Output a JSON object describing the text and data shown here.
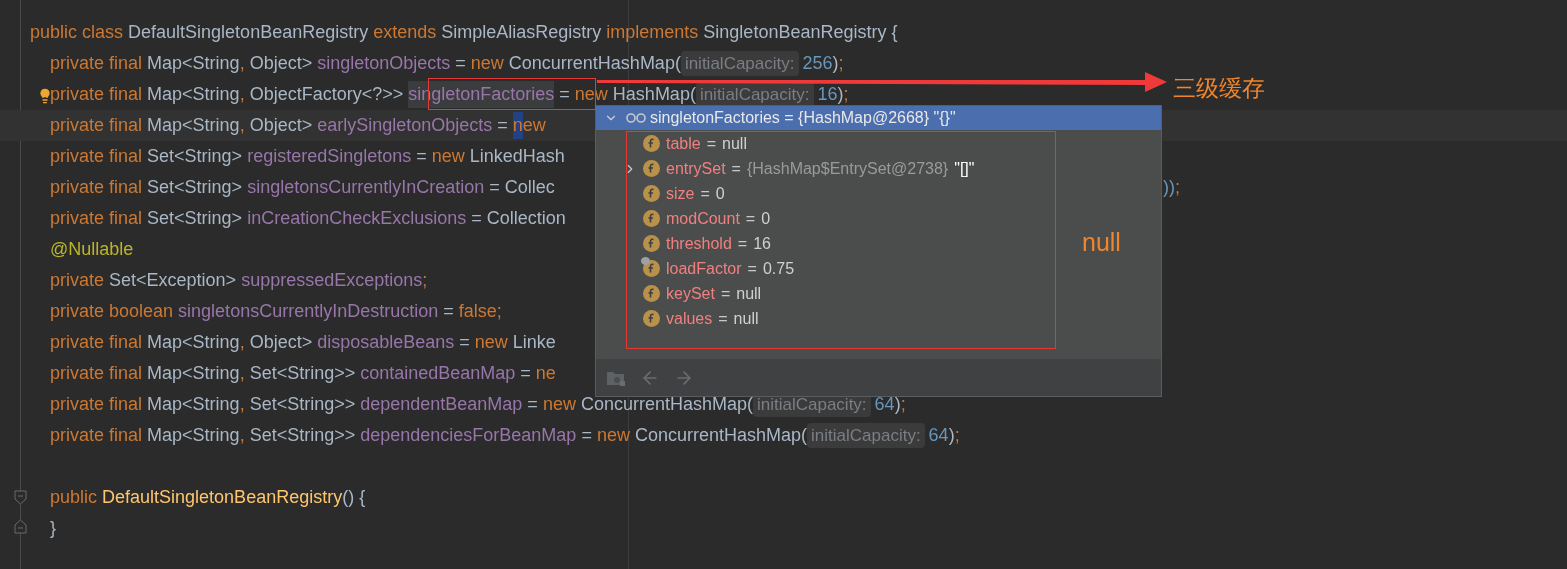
{
  "editor": {
    "lines": [
      {
        "current": false,
        "indented": false,
        "tokens": [
          {
            "kind": "kw",
            "text": "public class "
          },
          {
            "kind": "plain",
            "text": "DefaultSingletonBeanRegistry "
          },
          {
            "kind": "kw",
            "text": "extends "
          },
          {
            "kind": "plain",
            "text": "SimpleAliasRegistry "
          },
          {
            "kind": "kw",
            "text": "implements "
          },
          {
            "kind": "plain",
            "text": "SingletonBeanRegistry {"
          }
        ]
      },
      {
        "current": false,
        "indented": true,
        "tokens": [
          {
            "kind": "kw",
            "text": "private final "
          },
          {
            "kind": "plain",
            "text": "Map<String"
          },
          {
            "kind": "kw",
            "text": ", "
          },
          {
            "kind": "plain",
            "text": "Object> "
          },
          {
            "kind": "field",
            "text": "singletonObjects"
          },
          {
            "kind": "plain",
            "text": " = "
          },
          {
            "kind": "kw",
            "text": "new "
          },
          {
            "kind": "plain",
            "text": "ConcurrentHashMap("
          },
          {
            "kind": "hint",
            "text": "initialCapacity:"
          },
          {
            "kind": "num",
            "text": "256"
          },
          {
            "kind": "plain",
            "text": ")"
          },
          {
            "kind": "kw",
            "text": ";"
          }
        ]
      },
      {
        "current": false,
        "indented": true,
        "gutter": {
          "kind": "bulb"
        },
        "tokens": [
          {
            "kind": "kw",
            "text": "private final "
          },
          {
            "kind": "plain",
            "text": "Map<String"
          },
          {
            "kind": "kw",
            "text": ", "
          },
          {
            "kind": "plain",
            "text": "ObjectFactory<?>> "
          },
          {
            "kind": "usage",
            "text": "singletonFactories"
          },
          {
            "kind": "plain",
            "text": " = "
          },
          {
            "kind": "kw",
            "text": "new "
          },
          {
            "kind": "plain",
            "text": "HashMap("
          },
          {
            "kind": "hint",
            "text": "initialCapacity:"
          },
          {
            "kind": "num",
            "text": "16"
          },
          {
            "kind": "plain",
            "text": ")"
          },
          {
            "kind": "kw",
            "text": ";"
          }
        ]
      },
      {
        "current": true,
        "indented": true,
        "tokens": [
          {
            "kind": "kw",
            "text": "private final "
          },
          {
            "kind": "plain",
            "text": "Map<String"
          },
          {
            "kind": "kw",
            "text": ", "
          },
          {
            "kind": "plain",
            "text": "Object> "
          },
          {
            "kind": "field",
            "text": "earlySingletonObjects"
          },
          {
            "kind": "plain",
            "text": " = "
          },
          {
            "kind": "match",
            "text": "n"
          },
          {
            "kind": "kw",
            "text": "ew"
          }
        ]
      },
      {
        "current": false,
        "indented": true,
        "tokens": [
          {
            "kind": "kw",
            "text": "private final "
          },
          {
            "kind": "plain",
            "text": "Set<String> "
          },
          {
            "kind": "field",
            "text": "registeredSingletons"
          },
          {
            "kind": "plain",
            "text": " = "
          },
          {
            "kind": "kw",
            "text": "new "
          },
          {
            "kind": "plain",
            "text": "LinkedHash"
          }
        ]
      },
      {
        "current": false,
        "indented": true,
        "tokens": [
          {
            "kind": "kw",
            "text": "private final "
          },
          {
            "kind": "plain",
            "text": "Set<String> "
          },
          {
            "kind": "field",
            "text": "singletonsCurrentlyInCreation"
          },
          {
            "kind": "plain",
            "text": " = "
          },
          {
            "kind": "plain",
            "text": "Collec"
          }
        ],
        "tail": [
          {
            "kind": "num",
            "text": "))"
          },
          {
            "kind": "kw",
            "text": ";"
          }
        ]
      },
      {
        "current": false,
        "indented": true,
        "tokens": [
          {
            "kind": "kw",
            "text": "private final "
          },
          {
            "kind": "plain",
            "text": "Set<String> "
          },
          {
            "kind": "field",
            "text": "inCreationCheckExclusions"
          },
          {
            "kind": "plain",
            "text": " = "
          },
          {
            "kind": "plain",
            "text": "Collection"
          }
        ]
      },
      {
        "current": false,
        "indented": true,
        "tokens": [
          {
            "kind": "annot",
            "text": "@Nullable"
          }
        ]
      },
      {
        "current": false,
        "indented": true,
        "tokens": [
          {
            "kind": "kw",
            "text": "private "
          },
          {
            "kind": "plain",
            "text": "Set<Exception> "
          },
          {
            "kind": "field",
            "text": "suppressedExceptions"
          },
          {
            "kind": "kw",
            "text": ";"
          }
        ]
      },
      {
        "current": false,
        "indented": true,
        "tokens": [
          {
            "kind": "kw",
            "text": "private boolean "
          },
          {
            "kind": "field",
            "text": "singletonsCurrentlyInDestruction"
          },
          {
            "kind": "plain",
            "text": " = "
          },
          {
            "kind": "kw",
            "text": "false;"
          }
        ]
      },
      {
        "current": false,
        "indented": true,
        "tokens": [
          {
            "kind": "kw",
            "text": "private final "
          },
          {
            "kind": "plain",
            "text": "Map<String"
          },
          {
            "kind": "kw",
            "text": ", "
          },
          {
            "kind": "plain",
            "text": "Object> "
          },
          {
            "kind": "field",
            "text": "disposableBeans"
          },
          {
            "kind": "plain",
            "text": " = "
          },
          {
            "kind": "kw",
            "text": "new "
          },
          {
            "kind": "plain",
            "text": "Linke"
          }
        ]
      },
      {
        "current": false,
        "indented": true,
        "tokens": [
          {
            "kind": "kw",
            "text": "private final "
          },
          {
            "kind": "plain",
            "text": "Map<String"
          },
          {
            "kind": "kw",
            "text": ", "
          },
          {
            "kind": "plain",
            "text": "Set<String>> "
          },
          {
            "kind": "field",
            "text": "containedBeanMap"
          },
          {
            "kind": "plain",
            "text": " = "
          },
          {
            "kind": "kw",
            "text": "ne"
          }
        ]
      },
      {
        "current": false,
        "indented": true,
        "tokens": [
          {
            "kind": "kw",
            "text": "private final "
          },
          {
            "kind": "plain",
            "text": "Map<String"
          },
          {
            "kind": "kw",
            "text": ", "
          },
          {
            "kind": "plain",
            "text": "Set<String>> "
          },
          {
            "kind": "field",
            "text": "dependentBeanMap"
          },
          {
            "kind": "plain",
            "text": " = "
          },
          {
            "kind": "kw",
            "text": "new "
          },
          {
            "kind": "plain",
            "text": "ConcurrentHashMap("
          },
          {
            "kind": "hint",
            "text": "initialCapacity:"
          },
          {
            "kind": "num",
            "text": "64"
          },
          {
            "kind": "plain",
            "text": ")"
          },
          {
            "kind": "kw",
            "text": ";"
          }
        ]
      },
      {
        "current": false,
        "indented": true,
        "tokens": [
          {
            "kind": "kw",
            "text": "private final "
          },
          {
            "kind": "plain",
            "text": "Map<String"
          },
          {
            "kind": "kw",
            "text": ", "
          },
          {
            "kind": "plain",
            "text": "Set<String>> "
          },
          {
            "kind": "field",
            "text": "dependenciesForBeanMap"
          },
          {
            "kind": "plain",
            "text": " = "
          },
          {
            "kind": "kw",
            "text": "new "
          },
          {
            "kind": "plain",
            "text": "ConcurrentHashMap("
          },
          {
            "kind": "hint",
            "text": "initialCapacity:"
          },
          {
            "kind": "num",
            "text": "64"
          },
          {
            "kind": "plain",
            "text": ")"
          },
          {
            "kind": "kw",
            "text": ";"
          }
        ]
      },
      {
        "current": false
      },
      {
        "current": false,
        "indented": true,
        "gutter": {
          "kind": "fold-start"
        },
        "tokens": [
          {
            "kind": "kw",
            "text": "public "
          },
          {
            "kind": "method",
            "text": "DefaultSingletonBeanRegistry"
          },
          {
            "kind": "plain",
            "text": "() {"
          }
        ]
      },
      {
        "current": false,
        "indented": true,
        "gutter": {
          "kind": "fold-end"
        },
        "tokens": [
          {
            "kind": "plain",
            "text": "}"
          }
        ]
      }
    ]
  },
  "debugger_popup": {
    "root": {
      "name": "singletonFactories",
      "op": "=",
      "value": "{HashMap@2668}",
      "string": "\"{}\"",
      "expanded": true,
      "selected": true,
      "children": [
        {
          "name": "table",
          "op": "=",
          "value": "null",
          "expandable": false,
          "marked": false
        },
        {
          "name": "entrySet",
          "op": "=",
          "value": "{HashMap$EntrySet@2738}",
          "string": "\"[]\"",
          "expandable": true,
          "expanded": false,
          "marked": false
        },
        {
          "name": "size",
          "op": "=",
          "value": "0",
          "expandable": false,
          "marked": false
        },
        {
          "name": "modCount",
          "op": "=",
          "value": "0",
          "expandable": false,
          "marked": false
        },
        {
          "name": "threshold",
          "op": "=",
          "value": "16",
          "expandable": false,
          "marked": false
        },
        {
          "name": "loadFactor",
          "op": "=",
          "value": "0.75",
          "expandable": false,
          "marked": true
        },
        {
          "name": "keySet",
          "op": "=",
          "value": "null",
          "expandable": false,
          "marked": false
        },
        {
          "name": "values",
          "op": "=",
          "value": "null",
          "expandable": false,
          "marked": false
        }
      ]
    }
  },
  "annotations": [
    {
      "kind": "arrow-label",
      "text": "三级缓存"
    },
    {
      "kind": "box-label",
      "text": "null"
    }
  ]
}
